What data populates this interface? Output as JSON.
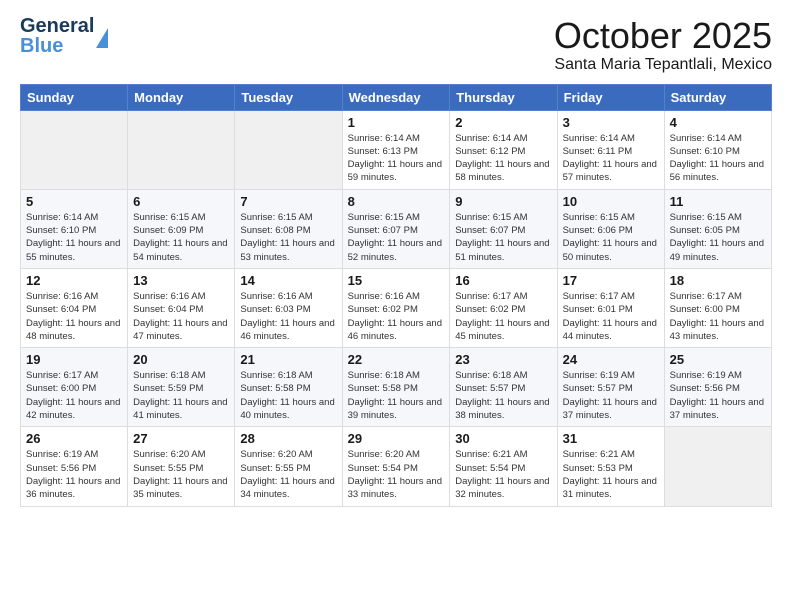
{
  "header": {
    "logo_line1": "General",
    "logo_line2": "Blue",
    "month": "October 2025",
    "location": "Santa Maria Tepantlali, Mexico"
  },
  "calendar": {
    "days_of_week": [
      "Sunday",
      "Monday",
      "Tuesday",
      "Wednesday",
      "Thursday",
      "Friday",
      "Saturday"
    ],
    "weeks": [
      [
        {
          "day": "",
          "info": ""
        },
        {
          "day": "",
          "info": ""
        },
        {
          "day": "",
          "info": ""
        },
        {
          "day": "1",
          "info": "Sunrise: 6:14 AM\nSunset: 6:13 PM\nDaylight: 11 hours\nand 59 minutes."
        },
        {
          "day": "2",
          "info": "Sunrise: 6:14 AM\nSunset: 6:12 PM\nDaylight: 11 hours\nand 58 minutes."
        },
        {
          "day": "3",
          "info": "Sunrise: 6:14 AM\nSunset: 6:11 PM\nDaylight: 11 hours\nand 57 minutes."
        },
        {
          "day": "4",
          "info": "Sunrise: 6:14 AM\nSunset: 6:10 PM\nDaylight: 11 hours\nand 56 minutes."
        }
      ],
      [
        {
          "day": "5",
          "info": "Sunrise: 6:14 AM\nSunset: 6:10 PM\nDaylight: 11 hours\nand 55 minutes."
        },
        {
          "day": "6",
          "info": "Sunrise: 6:15 AM\nSunset: 6:09 PM\nDaylight: 11 hours\nand 54 minutes."
        },
        {
          "day": "7",
          "info": "Sunrise: 6:15 AM\nSunset: 6:08 PM\nDaylight: 11 hours\nand 53 minutes."
        },
        {
          "day": "8",
          "info": "Sunrise: 6:15 AM\nSunset: 6:07 PM\nDaylight: 11 hours\nand 52 minutes."
        },
        {
          "day": "9",
          "info": "Sunrise: 6:15 AM\nSunset: 6:07 PM\nDaylight: 11 hours\nand 51 minutes."
        },
        {
          "day": "10",
          "info": "Sunrise: 6:15 AM\nSunset: 6:06 PM\nDaylight: 11 hours\nand 50 minutes."
        },
        {
          "day": "11",
          "info": "Sunrise: 6:15 AM\nSunset: 6:05 PM\nDaylight: 11 hours\nand 49 minutes."
        }
      ],
      [
        {
          "day": "12",
          "info": "Sunrise: 6:16 AM\nSunset: 6:04 PM\nDaylight: 11 hours\nand 48 minutes."
        },
        {
          "day": "13",
          "info": "Sunrise: 6:16 AM\nSunset: 6:04 PM\nDaylight: 11 hours\nand 47 minutes."
        },
        {
          "day": "14",
          "info": "Sunrise: 6:16 AM\nSunset: 6:03 PM\nDaylight: 11 hours\nand 46 minutes."
        },
        {
          "day": "15",
          "info": "Sunrise: 6:16 AM\nSunset: 6:02 PM\nDaylight: 11 hours\nand 46 minutes."
        },
        {
          "day": "16",
          "info": "Sunrise: 6:17 AM\nSunset: 6:02 PM\nDaylight: 11 hours\nand 45 minutes."
        },
        {
          "day": "17",
          "info": "Sunrise: 6:17 AM\nSunset: 6:01 PM\nDaylight: 11 hours\nand 44 minutes."
        },
        {
          "day": "18",
          "info": "Sunrise: 6:17 AM\nSunset: 6:00 PM\nDaylight: 11 hours\nand 43 minutes."
        }
      ],
      [
        {
          "day": "19",
          "info": "Sunrise: 6:17 AM\nSunset: 6:00 PM\nDaylight: 11 hours\nand 42 minutes."
        },
        {
          "day": "20",
          "info": "Sunrise: 6:18 AM\nSunset: 5:59 PM\nDaylight: 11 hours\nand 41 minutes."
        },
        {
          "day": "21",
          "info": "Sunrise: 6:18 AM\nSunset: 5:58 PM\nDaylight: 11 hours\nand 40 minutes."
        },
        {
          "day": "22",
          "info": "Sunrise: 6:18 AM\nSunset: 5:58 PM\nDaylight: 11 hours\nand 39 minutes."
        },
        {
          "day": "23",
          "info": "Sunrise: 6:18 AM\nSunset: 5:57 PM\nDaylight: 11 hours\nand 38 minutes."
        },
        {
          "day": "24",
          "info": "Sunrise: 6:19 AM\nSunset: 5:57 PM\nDaylight: 11 hours\nand 37 minutes."
        },
        {
          "day": "25",
          "info": "Sunrise: 6:19 AM\nSunset: 5:56 PM\nDaylight: 11 hours\nand 37 minutes."
        }
      ],
      [
        {
          "day": "26",
          "info": "Sunrise: 6:19 AM\nSunset: 5:56 PM\nDaylight: 11 hours\nand 36 minutes."
        },
        {
          "day": "27",
          "info": "Sunrise: 6:20 AM\nSunset: 5:55 PM\nDaylight: 11 hours\nand 35 minutes."
        },
        {
          "day": "28",
          "info": "Sunrise: 6:20 AM\nSunset: 5:55 PM\nDaylight: 11 hours\nand 34 minutes."
        },
        {
          "day": "29",
          "info": "Sunrise: 6:20 AM\nSunset: 5:54 PM\nDaylight: 11 hours\nand 33 minutes."
        },
        {
          "day": "30",
          "info": "Sunrise: 6:21 AM\nSunset: 5:54 PM\nDaylight: 11 hours\nand 32 minutes."
        },
        {
          "day": "31",
          "info": "Sunrise: 6:21 AM\nSunset: 5:53 PM\nDaylight: 11 hours\nand 31 minutes."
        },
        {
          "day": "",
          "info": ""
        }
      ]
    ]
  }
}
